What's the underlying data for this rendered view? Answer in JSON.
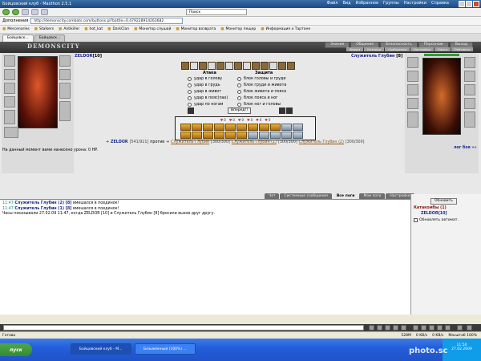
{
  "browser": {
    "title": "Бойцовский клуб - Maxthon 2.5.1",
    "menu": [
      "Файл",
      "Вид",
      "Избранное",
      "Группы",
      "Настройки",
      "Справка"
    ],
    "nav_dropdown": "Дополнения",
    "search_placeholder": "Поиск",
    "address": "http://demonscity.combats.com/buttons.pl?battle=0.479228914263682",
    "bookmarks": [
      "Mercenaries",
      "Stalkers",
      "Antikiller",
      "hot_kat",
      "DarkClan",
      "Монитор слушай",
      "Монитор возврата",
      "Монитор пещер",
      "Информация о Тартане"
    ],
    "tabs": [
      "Бойцовск...",
      "Бойцовск..."
    ]
  },
  "game": {
    "logo": "DEMONSCITY",
    "topmenu": [
      "Знания",
      "Общение",
      "Безопасность",
      "Персонаж",
      "Выход"
    ],
    "submenu": [
      "Форум",
      "Кузница",
      "Сообщения",
      "Настройки",
      "Карта",
      "Рейтинги"
    ],
    "player": {
      "name": "ZELDOR",
      "level": "[10]"
    },
    "enemy": {
      "name": "Служитель Глубин",
      "level": "[8]"
    },
    "attack_title": "Атака",
    "defense_title": "Защита",
    "attacks": [
      "удар в голову",
      "удар в грудь",
      "удар в живот",
      "удар в пояс(пах)",
      "удар по ногам"
    ],
    "defenses": [
      "блок головы и груди",
      "блок груди и живота",
      "блок живота и пояса",
      "блок пояса и ног",
      "блок ног и головы"
    ],
    "forward_button": "Вперед!!",
    "effect_counts": [
      "0",
      "0",
      "0",
      "0",
      "0",
      "0"
    ],
    "vs_line": {
      "player": "ZELDOR",
      "player_hp": "[541/921]",
      "vs": "против",
      "enemy1": "Служитель Глубин",
      "enemy1_hp": "[300/300]",
      "enemy2": "Служитель Глубин (1)",
      "enemy2_hp": "[300/300]",
      "enemy3": "Служитель Глубин (2)",
      "enemy3_hp": "[300/300]"
    },
    "damage_text": "На данный момент вами нанесено урона: 0 HP.",
    "battle_log_link": "лог боя »»"
  },
  "chat": {
    "tabs": [
      "Чат",
      "Системные сообщения",
      "Все логи",
      "Мои логи",
      "Настройки"
    ],
    "active_tab": 2,
    "messages": [
      {
        "time": "11:47",
        "who": "Служитель Глубин (2) [8]",
        "text": "вмешался в поединок!"
      },
      {
        "time": "11:47",
        "who": "Служитель Глубин (1) [8]",
        "text": "вмешался в поединок!"
      },
      {
        "time": "",
        "who": "",
        "text": "Часы показывали 27.02.09 11:47, когда ZELDOR [10] и Служитель Глубин [8] бросили вызов друг другу."
      }
    ],
    "refresh_button": "Обновить",
    "location": "Катакомбы (1)",
    "online_user": "ZELDOR[10]",
    "auto_refresh": "Обновлять автомат."
  },
  "status": {
    "left": "Готово",
    "right": [
      "528M",
      "0 KB/s",
      "0 KB/s",
      "Масштаб 100%"
    ]
  },
  "taskbar": {
    "start": "пуск",
    "tasks": [
      "Бойцовский клуб - М...",
      "Безымянный (100%) ..."
    ],
    "clock": "11:50",
    "date": "27.02.2009"
  },
  "watermark": "photo.sc"
}
